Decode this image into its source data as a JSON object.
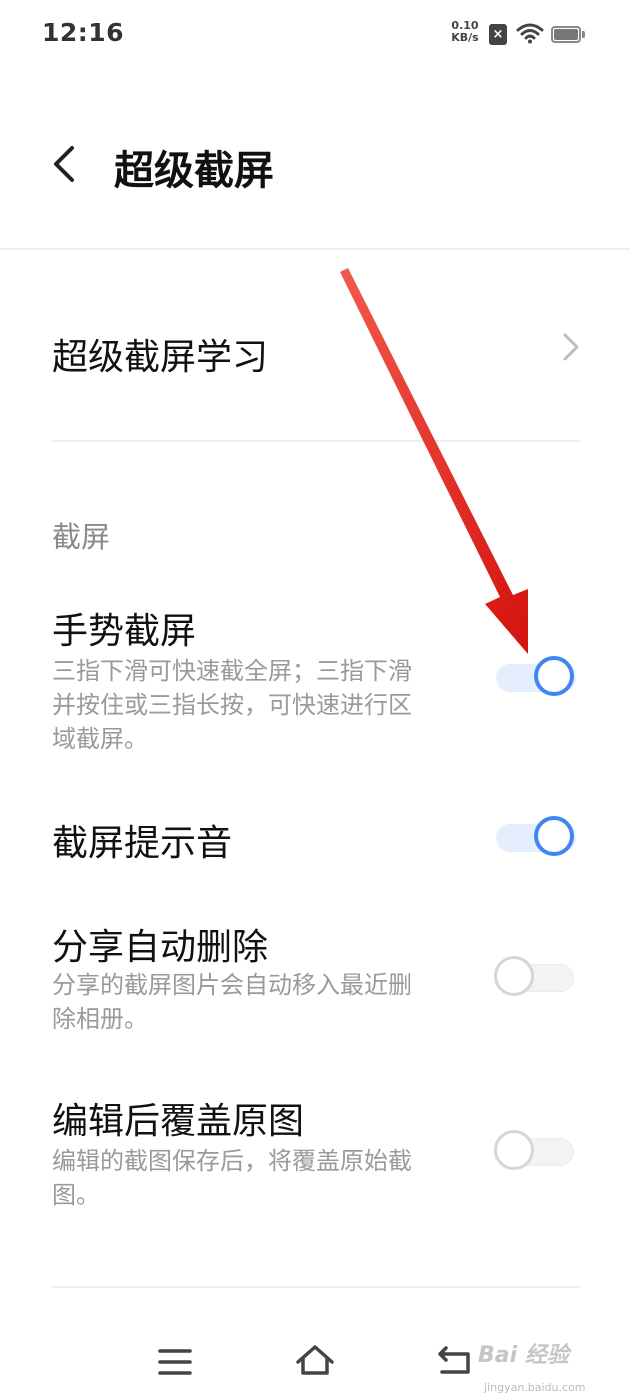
{
  "status_bar": {
    "time": "12:16",
    "speed_value": "0.10",
    "speed_unit": "KB/s",
    "sim_icon": "sim-error-icon",
    "wifi_icon": "wifi-icon",
    "battery_icon": "battery-icon"
  },
  "header": {
    "back_icon": "back-chevron-icon",
    "title": "超级截屏"
  },
  "learn_row": {
    "label": "超级截屏学习",
    "icon": "chevron-right-icon"
  },
  "section_header": "截屏",
  "settings": [
    {
      "title": "手势截屏",
      "description": "三指下滑可快速截全屏；三指下滑并按住或三指长按，可快速进行区域截屏。",
      "enabled": true
    },
    {
      "title": "截屏提示音",
      "description": "",
      "enabled": true
    },
    {
      "title": "分享自动删除",
      "description": "分享的截屏图片会自动移入最近删除相册。",
      "enabled": false
    },
    {
      "title": "编辑后覆盖原图",
      "description": "编辑的截图保存后，将覆盖原始截图。",
      "enabled": false
    }
  ],
  "nav_bar": {
    "menu_icon": "menu-icon",
    "home_icon": "home-icon",
    "back_icon": "back-icon"
  },
  "watermark": {
    "brand": "Bai 经验",
    "url": "jingyan.baidu.com"
  },
  "colors": {
    "accent": "#3e86f2",
    "arrow": "#e8201c"
  }
}
